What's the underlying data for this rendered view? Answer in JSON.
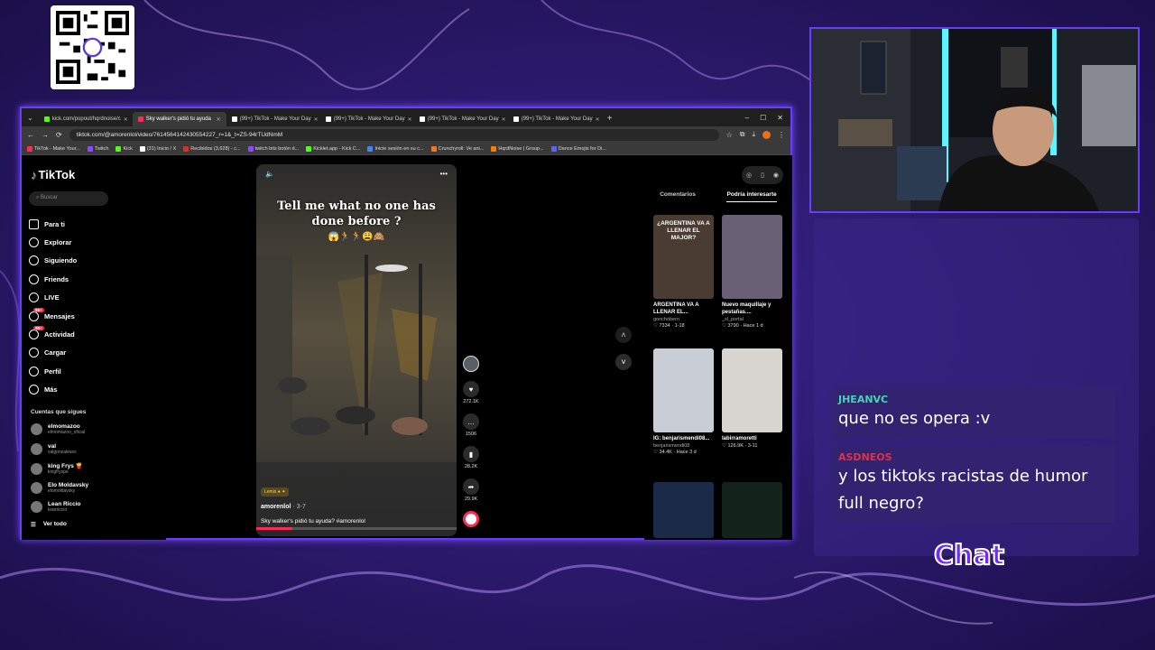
{
  "browser": {
    "tabs": [
      {
        "title": "kick.com/popout/hqrdnoise/c",
        "active": false,
        "color": "#53fc18"
      },
      {
        "title": "Sky walker's pidió tu ayuda",
        "active": true,
        "color": "#fe2c55"
      },
      {
        "title": "(99+) TikTok - Make Your Day",
        "active": false,
        "color": "#fff"
      },
      {
        "title": "(99+) TikTok - Make Your Day",
        "active": false,
        "color": "#fff"
      },
      {
        "title": "(99+) TikTok - Make Your Day",
        "active": false,
        "color": "#fff"
      },
      {
        "title": "(99+) TikTok - Make Your Day",
        "active": false,
        "color": "#fff"
      }
    ],
    "url": "tiktok.com/@amorenlol/video/7614564142430554227_r=1&_t=ZS-94rTUdNmM",
    "bookmarks": [
      "TikTok - Make Your...",
      "Twitch",
      "Kick",
      "(31) Inicio / X",
      "Recibidos (3,628) - c...",
      "twitch bits botón d...",
      "Kicklet.app - Kick C...",
      "Inicie sesión en su c...",
      "Crunchyroll: Ve ani...",
      "HqrdNoise | Group...",
      "Dance Emojis for Di..."
    ]
  },
  "sidebar": {
    "logo": "TikTok",
    "search_placeholder": "Buscar",
    "nav": [
      {
        "label": "Para ti",
        "icon": "home-icon"
      },
      {
        "label": "Explorar",
        "icon": "compass-icon"
      },
      {
        "label": "Siguiendo",
        "icon": "following-icon"
      },
      {
        "label": "Friends",
        "icon": "friends-icon"
      },
      {
        "label": "LIVE",
        "icon": "live-icon"
      },
      {
        "label": "Mensajes",
        "icon": "message-icon",
        "badge": "99+"
      },
      {
        "label": "Actividad",
        "icon": "bell-icon",
        "badge": "99+"
      },
      {
        "label": "Cargar",
        "icon": "upload-icon"
      },
      {
        "label": "Perfil",
        "icon": "profile-icon"
      },
      {
        "label": "Más",
        "icon": "more-icon"
      }
    ],
    "following_title": "Cuentas que sigues",
    "accounts": [
      {
        "name": "elmomazoo",
        "handle": "elmomazoo_oficial"
      },
      {
        "name": "val",
        "handle": "valgonzaleses"
      },
      {
        "name": "king Frys 🍟",
        "handle": "kingfryspe"
      },
      {
        "name": "Elo Moldavsky",
        "handle": "elomoldavsky"
      },
      {
        "name": "Lean Riccio",
        "handle": "leanriccio"
      }
    ],
    "see_all": "Ver todo"
  },
  "video": {
    "title_line1": "Tell me what no one has",
    "title_line2": "done before ?",
    "emoji": "😱🏃🏃😩🙈",
    "tag": "Lemis ● ✦",
    "username": "amorenlol",
    "date": "· 3-7",
    "caption": "Sky walker's pidió tu ayuda? #amorenlol",
    "actions": [
      {
        "icon": "heart-icon",
        "count": "272.1K"
      },
      {
        "icon": "comment-icon",
        "count": "1506"
      },
      {
        "icon": "bookmark-icon",
        "count": "28.2K"
      },
      {
        "icon": "share-icon",
        "count": "29.9K"
      }
    ]
  },
  "right_panel": {
    "tab_comments": "Comentarios",
    "tab_suggested": "Podría interesarte",
    "cards": [
      {
        "overlay": "¿ARGENTINA VA A LLENAR EL MAJOR?",
        "title": "ARGENTINA VA A LLENAR EL...",
        "user": "gonchobern",
        "meta": "♡ 7334 · 1-18",
        "color": "#4a3b33"
      },
      {
        "overlay": "",
        "title": "Nuevo maquillaje y pestañas....",
        "user": "_sl_portal",
        "meta": "♡ 3790 · Hace 1 d",
        "color": "#6a6075"
      },
      {
        "overlay": "",
        "title": "IG: benjarismendi08...",
        "user": "benjarismendi08",
        "meta": "♡ 34.4K · Hace 3 d",
        "color": "#c9ced6"
      },
      {
        "overlay": "",
        "title": "labirramoretti",
        "user": "",
        "meta": "♡ 126.9K · 3-11",
        "color": "#d9d5d0"
      },
      {
        "overlay": "",
        "title": "",
        "user": "",
        "meta": "",
        "color": "#1b2a48"
      },
      {
        "overlay": "",
        "title": "",
        "user": "",
        "meta": "",
        "color": "#14221c"
      }
    ]
  },
  "chat": {
    "label": "Chat",
    "messages": [
      {
        "user": "JHEANVC",
        "text": "que no es opera :v",
        "color": "#3fd8b4"
      },
      {
        "user": "ASDNEOS",
        "text": "y los tiktoks racistas de humor full negro?",
        "color": "#e0304a"
      }
    ]
  }
}
